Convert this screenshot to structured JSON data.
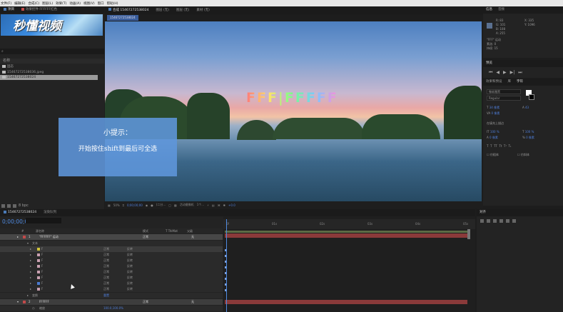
{
  "menubar": {
    "items": [
      "文件(F)",
      "编辑(E)",
      "合成(C)",
      "图层(L)",
      "效果(T)",
      "动画(A)",
      "视图(V)",
      "窗口",
      "帮助(H)"
    ]
  },
  "project": {
    "tabs": [
      "项目",
      "效果控件 FFFFFF红色"
    ],
    "logo_text": "秒懂视频",
    "name_header": "名称",
    "items": [
      {
        "name": "固态"
      },
      {
        "name": "15467272538036.jpeg"
      },
      {
        "name": "15467272538024"
      }
    ],
    "bottom_label": "8 bpc"
  },
  "viewer": {
    "tabs": [
      "合成 15467272538024",
      "图层 (无)",
      "图层 (无)",
      "素材 (无)"
    ],
    "comp_label": "15467272538024",
    "overlay_text": "FFF|FFFFF",
    "tip_title": "小提示：",
    "tip_body": "开始按住shift到最后可全选",
    "bar": {
      "zoom": "50%",
      "timecode": "0;00;00;00",
      "resolution": "(二分...",
      "camera": "活动摄像机",
      "views": "1个...",
      "exposure": "+0.0"
    }
  },
  "info_panel": {
    "tabs": [
      "信息",
      "音频"
    ],
    "r": "R: 83",
    "g": "G: 101",
    "b": "B: 108",
    "a": "A: 255",
    "x": "X: 335",
    "y": "Y: 1096",
    "text1": "\"FFF\" 运动",
    "text2": "素选: 0",
    "text3": "持续: 15"
  },
  "preview_panel": {
    "title": "预览"
  },
  "character_panel": {
    "tabs": [
      "效果和预设",
      "库",
      "字符"
    ],
    "font": "微软雅黑",
    "style": "Regular",
    "size": "34 像素",
    "leading": "43",
    "tracking": "0 像素",
    "baseline": "0 像素",
    "stroke_type": "在填充上描边",
    "vscale": "100 %",
    "hscale": "100 %",
    "indent": "0 像素",
    "bold_opt": "仿粗体",
    "italic_opt": "仿斜体"
  },
  "timeline": {
    "tabs": [
      "15467272538024",
      "渲染队列"
    ],
    "timecode": "0;00;00;00",
    "col_headers": [
      "#",
      "源名称",
      "模式",
      "T TrkMat",
      "父级"
    ],
    "rows": [
      {
        "type": "main",
        "num": "1",
        "name": "\"FFFFFF\" 运动",
        "mode": "正常",
        "parent": "无"
      },
      {
        "type": "sub",
        "name": "文本"
      },
      {
        "type": "sub",
        "name": "F",
        "mode": "无",
        "blend": "正常",
        "parent": "反转"
      },
      {
        "type": "sub",
        "name": "F",
        "mode": "无",
        "blend": "正常",
        "parent": "反转"
      },
      {
        "type": "sub",
        "name": "F",
        "mode": "无",
        "blend": "正常",
        "parent": "反转"
      },
      {
        "type": "sub",
        "name": "F",
        "mode": "无",
        "blend": "正常",
        "parent": "反转"
      },
      {
        "type": "sub",
        "name": "F",
        "mode": "无",
        "blend": "正常",
        "parent": "反转"
      },
      {
        "type": "sub",
        "name": "F",
        "mode": "无",
        "blend": "正常",
        "parent": "反转"
      },
      {
        "type": "sub",
        "name": "F",
        "mode": "无",
        "blend": "正常",
        "parent": "反转"
      },
      {
        "type": "sub",
        "name": "F",
        "mode": "无",
        "blend": "正常",
        "parent": "反转"
      },
      {
        "type": "sub",
        "name": "变换",
        "mode": "重置"
      },
      {
        "type": "main",
        "num": "2",
        "name": "FFFFFF",
        "mode": "正常",
        "parent": "无"
      },
      {
        "type": "sub",
        "name": "缩放",
        "mode": "100.0,100.0%"
      }
    ],
    "ruler_ticks": [
      "0f",
      "01s",
      "02s",
      "03s",
      "04s",
      "05s"
    ]
  },
  "align_panel": {
    "title": "对齐"
  }
}
